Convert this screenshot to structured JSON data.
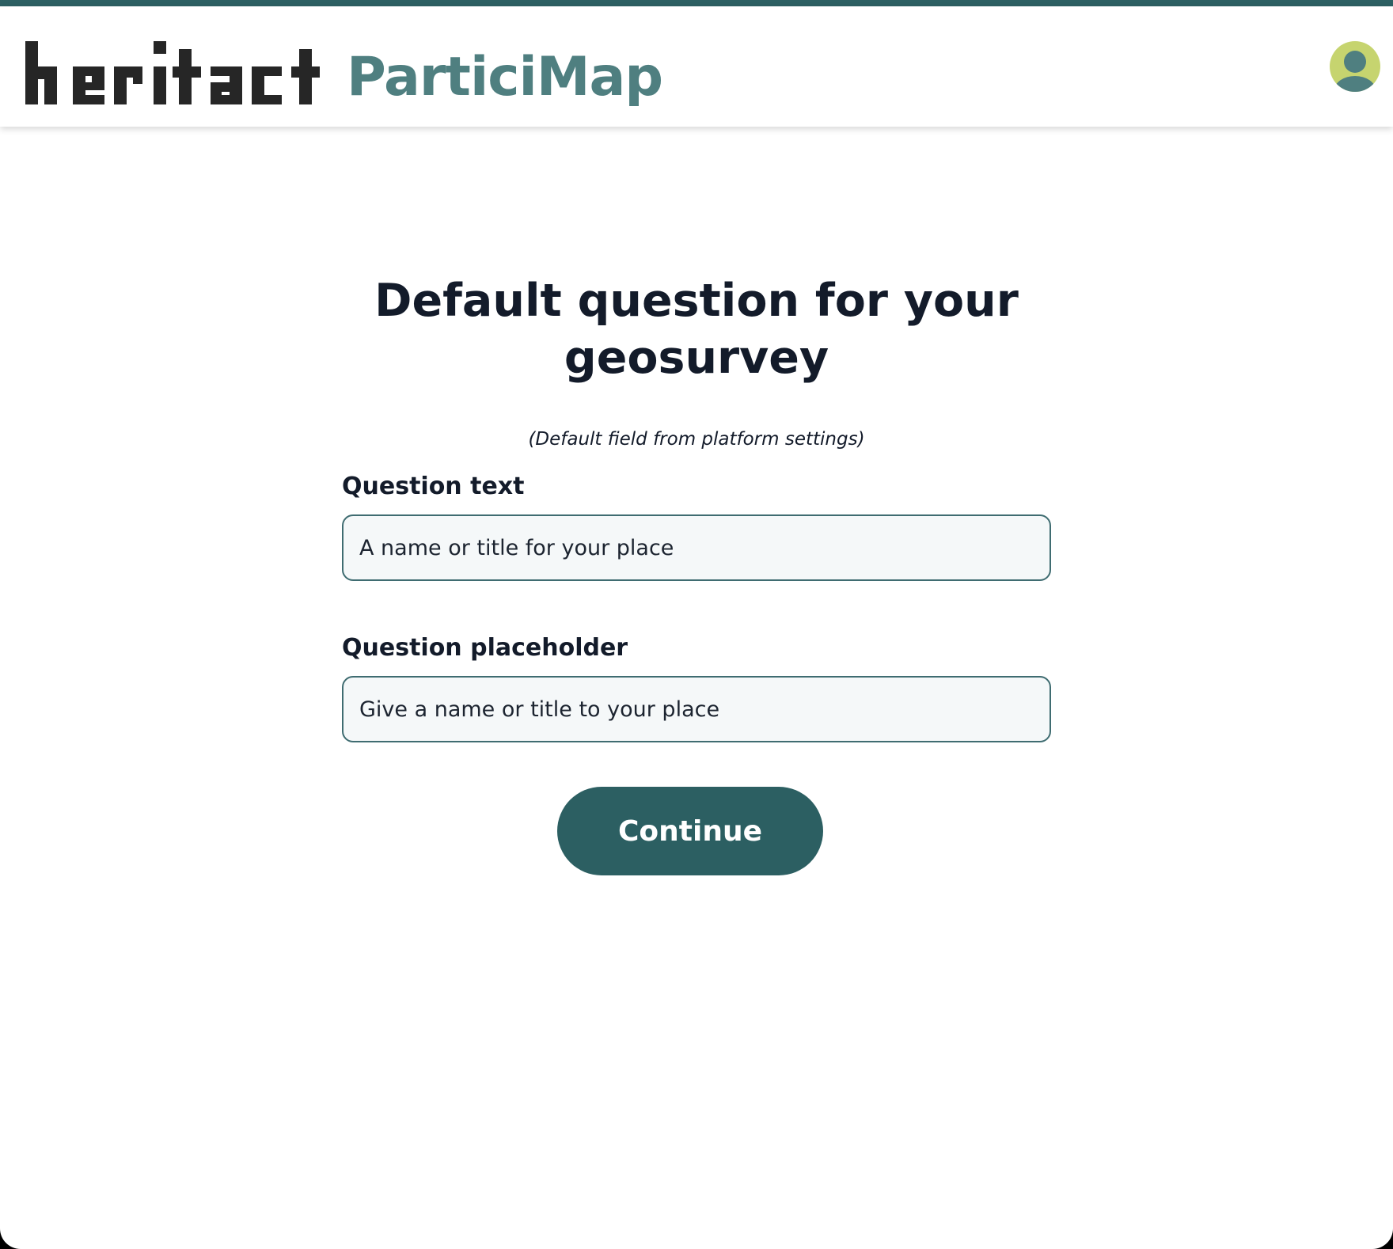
{
  "header": {
    "brand_logo_text": "heritact",
    "app_name": "ParticiMap"
  },
  "main": {
    "title": "Default question for your geosurvey",
    "subtitle": "(Default field from platform settings)",
    "question_text": {
      "label": "Question text",
      "value": "A name or title for your place"
    },
    "question_placeholder": {
      "label": "Question placeholder",
      "value": "Give a name or title to your place"
    },
    "continue_label": "Continue"
  },
  "colors": {
    "accent": "#2c5f62",
    "brand_text": "#4f7f80",
    "avatar_bg": "#c6d46f",
    "heading": "#131b2a"
  },
  "icons": {
    "avatar": "user-avatar-icon",
    "logo": "heritact-logo"
  }
}
